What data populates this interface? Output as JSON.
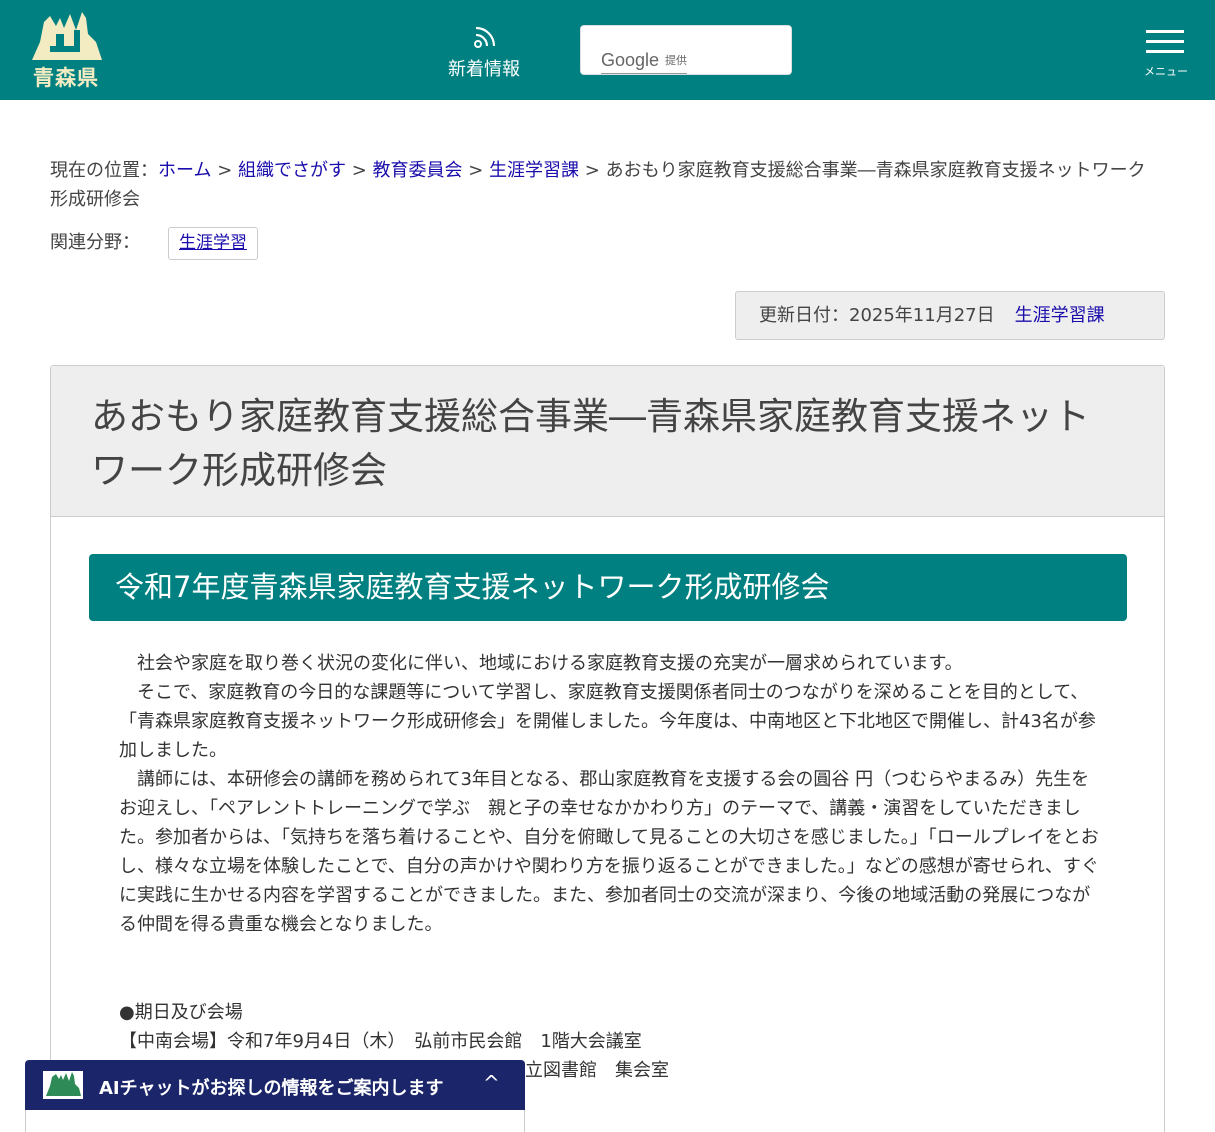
{
  "header": {
    "logo_text": "青森県",
    "news_label": "新着情報",
    "search_brand": "Google",
    "search_brand_suffix": "提供",
    "menu_label": "メニュー",
    "colors": {
      "header_bg": "#008080",
      "logo": "#f3ecc2"
    }
  },
  "breadcrumb": {
    "prefix": "現在の位置：",
    "items": [
      "ホーム",
      "組織でさがす",
      "教育委員会",
      "生涯学習課"
    ],
    "separator": " > ",
    "current": "あおもり家庭教育支援総合事業―青森県家庭教育支援ネットワーク形成研修会"
  },
  "related": {
    "label": "関連分野：",
    "tag": "生涯学習"
  },
  "update": {
    "date_text": "更新日付：2025年11月27日",
    "department": "生涯学習課"
  },
  "article": {
    "title": "あおもり家庭教育支援総合事業―青森県家庭教育支援ネットワーク形成研修会",
    "section_heading": "令和7年度青森県家庭教育支援ネットワーク形成研修会",
    "paragraphs": [
      "社会や家庭を取り巻く状況の変化に伴い、地域における家庭教育支援の充実が一層求められています。",
      "そこで、家庭教育の今日的な課題等について学習し、家庭教育支援関係者同士のつながりを深めることを目的として、「青森県家庭教育支援ネットワーク形成研修会」を開催しました。今年度は、中南地区と下北地区で開催し、計43名が参加しました。",
      "講師には、本研修会の講師を務められて3年目となる、郡山家庭教育を支援する会の圓谷 円（つむらやまるみ）先生をお迎えし、「ペアレントトレーニングで学ぶ　親と子の幸せなかかわり方」のテーマで、講義・演習をしていただきました。参加者からは、「気持ちを落ち着けることや、自分を俯瞰して見ることの大切さを感じました。」「ロールプレイをとおし、様々な立場を体験したことで、自分の声かけや関わり方を振り返ることができました。」などの感想が寄せられ、すぐに実践に生かせる内容を学習することができました。また、参加者同士の交流が深まり、今後の地域活動の発展につながる仲間を得る貴重な機会となりました。"
    ],
    "venue_heading": "●期日及び会場",
    "venue_lines": [
      "【中南会場】令和7年9月4日（木）　弘前市民会館　1階大会議室",
      "立図書館　集会室"
    ]
  },
  "ai_chat": {
    "label": "AIチャットがお探しの情報をご案内します",
    "chevron": "^",
    "bg_color": "#1b2569"
  }
}
